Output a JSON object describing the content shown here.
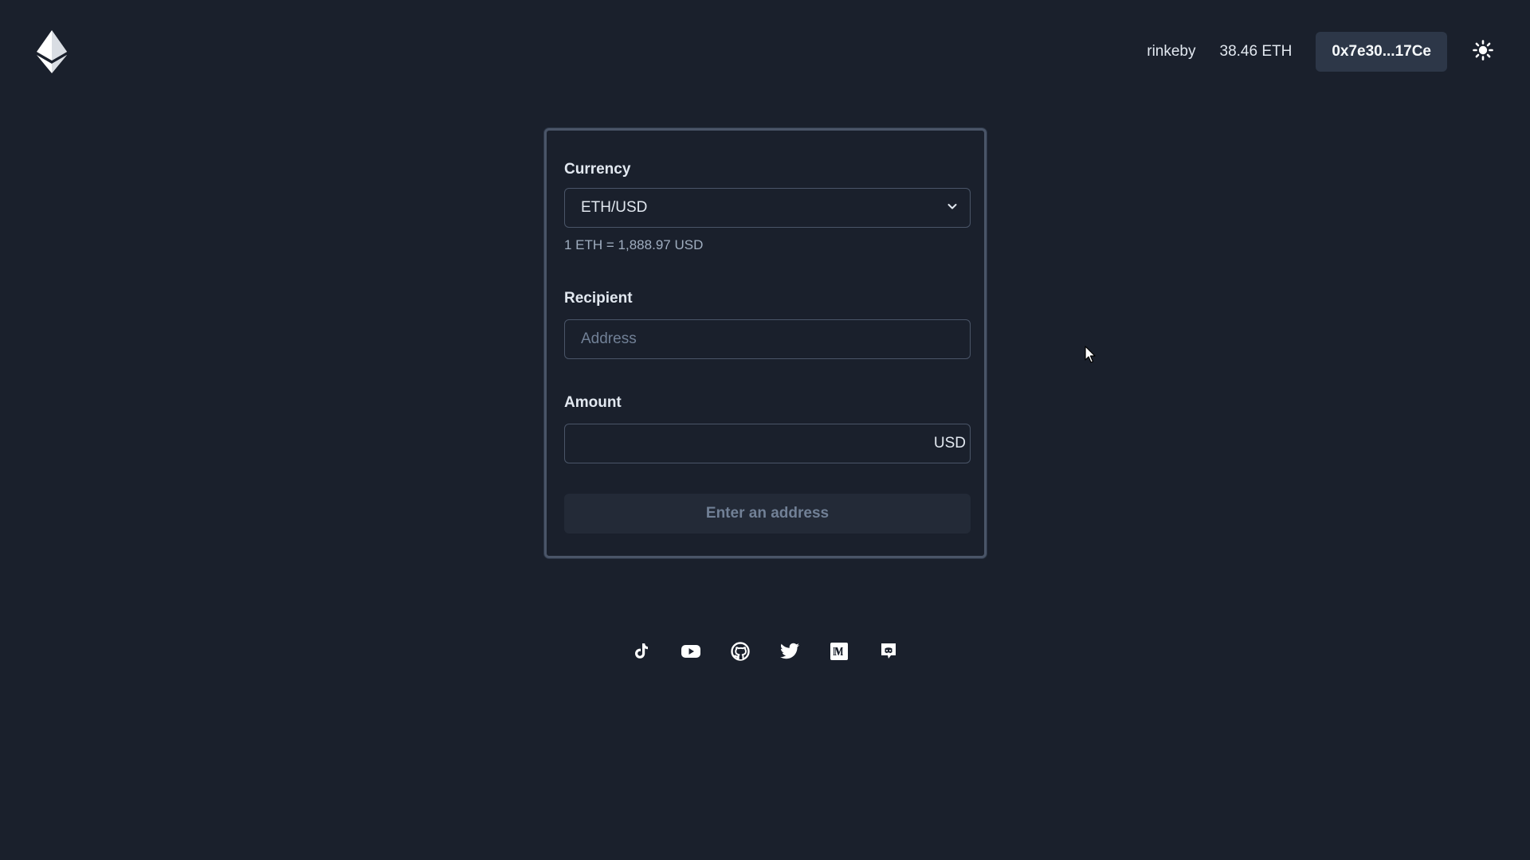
{
  "header": {
    "logo_icon": "ethereum-logo-icon",
    "network": "rinkeby",
    "balance": "38.46 ETH",
    "account": "0x7e30...17Ce",
    "theme_icon": "sun-icon"
  },
  "form": {
    "currency_label": "Currency",
    "currency_value": "ETH/USD",
    "currency_dropdown_icon": "chevron-down-icon",
    "rate": "1 ETH = 1,888.97 USD",
    "recipient_label": "Recipient",
    "recipient_placeholder": "Address",
    "recipient_value": "",
    "amount_label": "Amount",
    "amount_value": "",
    "amount_unit": "USD",
    "submit_label": "Enter an address"
  },
  "socials": [
    {
      "name": "tiktok",
      "icon": "tiktok-icon"
    },
    {
      "name": "youtube",
      "icon": "youtube-icon"
    },
    {
      "name": "github",
      "icon": "github-icon"
    },
    {
      "name": "twitter",
      "icon": "twitter-icon"
    },
    {
      "name": "medium",
      "icon": "medium-icon"
    },
    {
      "name": "discord",
      "icon": "discord-icon"
    }
  ],
  "colors": {
    "background": "#1a202c",
    "card_border": "#4a5568",
    "account_button": "#2d3748",
    "muted_text": "#a0aec0",
    "placeholder_text": "#718096"
  }
}
